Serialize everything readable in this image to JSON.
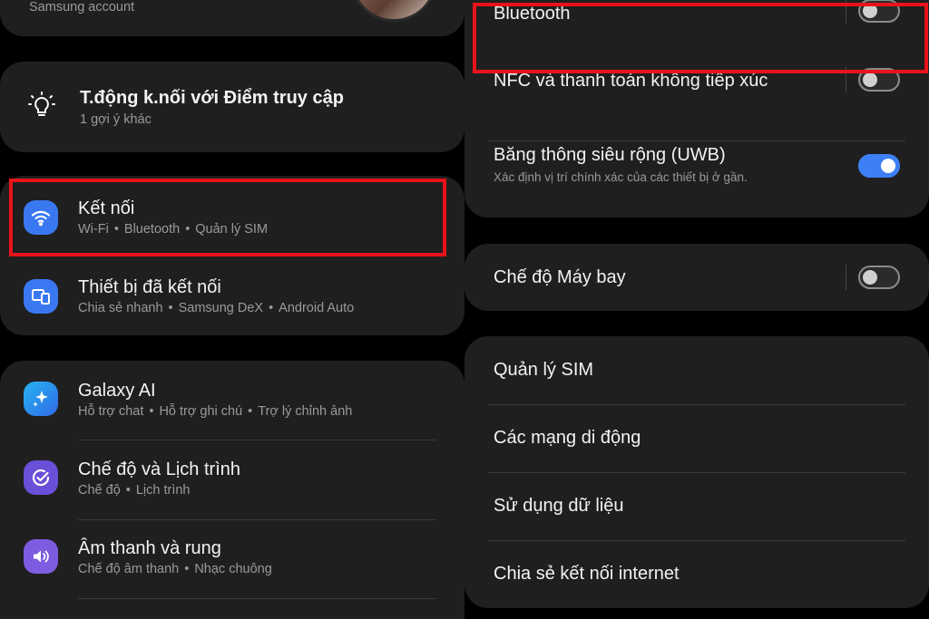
{
  "left": {
    "account_sub": "Samsung account",
    "suggestion": {
      "title": "T.động k.nối với Điểm truy cập",
      "sub": "1 gợi ý khác"
    },
    "items": [
      {
        "title": "Kết nối",
        "subs": [
          "Wi-Fi",
          "Bluetooth",
          "Quản lý SIM"
        ],
        "icon": "wifi-icon",
        "color": "#3a78f2"
      },
      {
        "title": "Thiết bị đã kết nối",
        "subs": [
          "Chia sẻ nhanh",
          "Samsung DeX",
          "Android Auto"
        ],
        "icon": "connected-devices-icon",
        "color": "#3a78f2"
      },
      {
        "title": "Galaxy AI",
        "subs": [
          "Hỗ trợ chat",
          "Hỗ trợ ghi chú",
          "Trợ lý chỉnh ảnh"
        ],
        "icon": "sparkle-icon",
        "color": "#2f86ee"
      },
      {
        "title": "Chế độ và Lịch trình",
        "subs": [
          "Chế độ",
          "Lịch trình"
        ],
        "icon": "modes-check-icon",
        "color": "#6a4fd8"
      },
      {
        "title": "Âm thanh và rung",
        "subs": [
          "Chế độ âm thanh",
          "Nhạc chuông"
        ],
        "icon": "speaker-icon",
        "color": "#7d5ce0"
      }
    ]
  },
  "right": {
    "toggles": [
      {
        "title": "Bluetooth",
        "on": false
      },
      {
        "title": "NFC và thanh toán không tiếp xúc",
        "on": false
      },
      {
        "title": "Băng thông siêu rộng (UWB)",
        "sub": "Xác định vị trí chính xác của các thiết bị ở gần.",
        "on": true
      }
    ],
    "airplane": {
      "title": "Chế độ Máy bay",
      "on": false
    },
    "more": [
      "Quản lý SIM",
      "Các mạng di động",
      "Sử dụng dữ liệu",
      "Chia sẻ kết nối internet"
    ]
  },
  "colors": {
    "highlight": "#e8131b",
    "toggle_on": "#3d80f5",
    "card": "#1f1f1f"
  }
}
